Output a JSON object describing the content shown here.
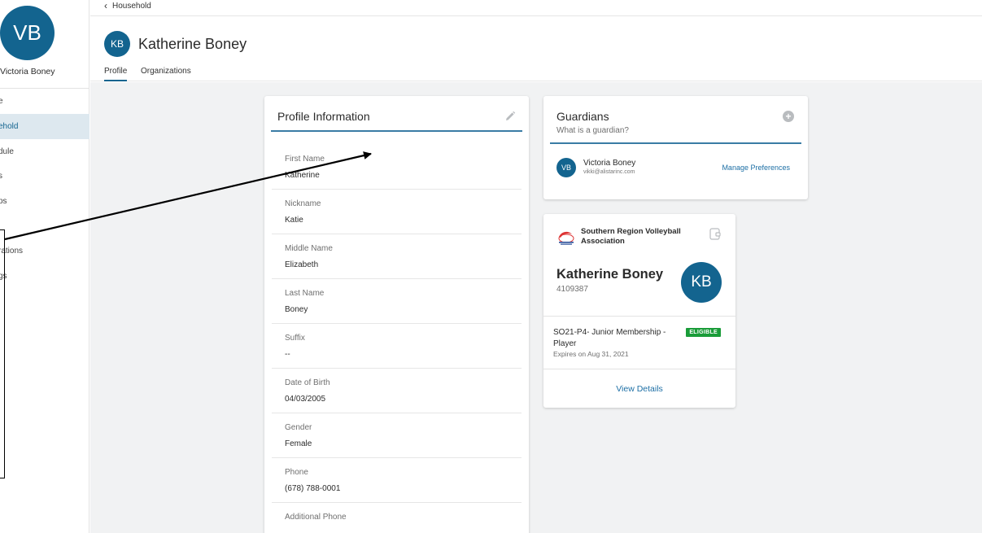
{
  "sidebar": {
    "avatar_initials": "VB",
    "user_name": "Victoria Boney",
    "items": [
      {
        "label": "e"
      },
      {
        "label": "ehold"
      },
      {
        "label": "dule"
      },
      {
        "label": "s"
      },
      {
        "label": "ps"
      },
      {
        "label": ""
      },
      {
        "label": "rations"
      },
      {
        "label": "gs"
      }
    ]
  },
  "topbar": {
    "back_label": "Household"
  },
  "header": {
    "avatar_initials": "KB",
    "title": "Katherine Boney",
    "tabs": [
      {
        "label": "Profile"
      },
      {
        "label": "Organizations"
      }
    ]
  },
  "profile": {
    "title": "Profile Information",
    "fields": [
      {
        "label": "First Name",
        "value": "Katherine"
      },
      {
        "label": "Nickname",
        "value": "Katie"
      },
      {
        "label": "Middle Name",
        "value": "Elizabeth"
      },
      {
        "label": "Last Name",
        "value": "Boney"
      },
      {
        "label": "Suffix",
        "value": "--"
      },
      {
        "label": "Date of Birth",
        "value": "04/03/2005"
      },
      {
        "label": "Gender",
        "value": "Female"
      },
      {
        "label": "Phone",
        "value": "(678) 788-0001"
      },
      {
        "label": "Additional Phone",
        "value": ""
      }
    ]
  },
  "guardians": {
    "title": "Guardians",
    "subtitle": "What is a guardian?",
    "guardian": {
      "initials": "VB",
      "name": "Victoria Boney",
      "email": "vikki@alistarinc.com"
    },
    "manage_label": "Manage Preferences"
  },
  "membership": {
    "org_name": "Southern Region Volleyball Association",
    "member_name": "Katherine Boney",
    "member_id": "4109387",
    "initials": "KB",
    "membership_name": "SO21-P4- Junior Membership - Player",
    "expires": "Expires on Aug 31, 2021",
    "status_badge": "ELIGIBLE",
    "view_details": "View Details"
  },
  "colors": {
    "primary": "#13648f",
    "link": "#1d6fa5",
    "eligible": "#1a9c39",
    "background": "#f1f2f3"
  }
}
